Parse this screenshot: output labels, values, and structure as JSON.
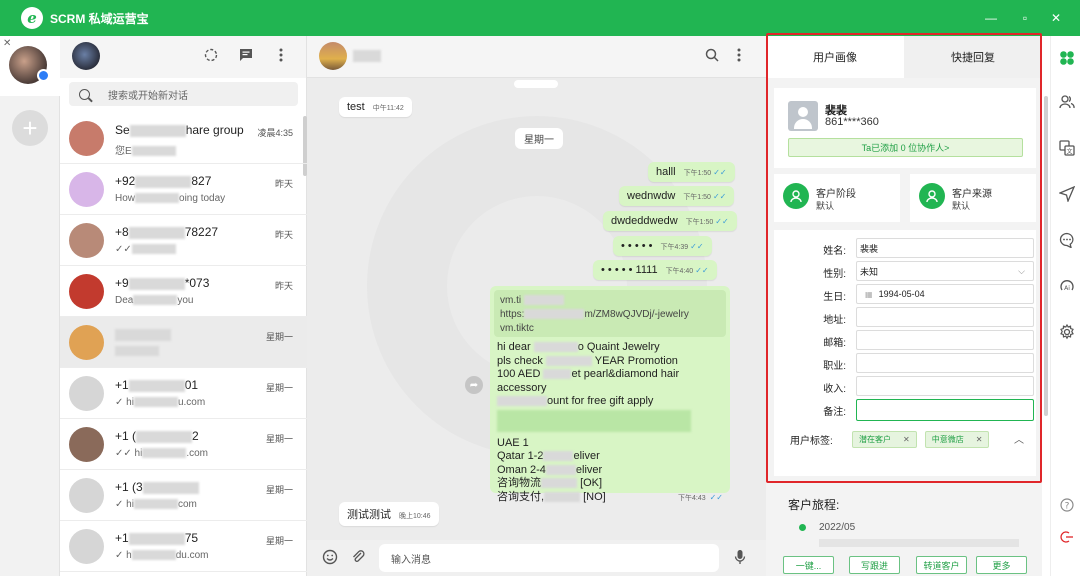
{
  "app": {
    "logo_letter": "e",
    "title": "SCRM 私域运营宝"
  },
  "window": {
    "minimize": "—",
    "maximize": "▫",
    "close": "✕"
  },
  "rail": {
    "close": "✕",
    "add": "+"
  },
  "chatlist": {
    "search_placeholder": "搜索或开始新对话",
    "items": [
      {
        "name_a": "Se",
        "name_b": "hare group",
        "preview": "您E",
        "time": "凌晨4:35",
        "avatar": "#c77b6b"
      },
      {
        "name_a": "+92",
        "name_b": "827",
        "preview": "How",
        "preview_b": "oing today",
        "time": "昨天",
        "avatar": "#d8b6e8"
      },
      {
        "name_a": "+8",
        "name_b": "78227",
        "preview": "✓✓",
        "time": "昨天",
        "avatar": "#b88a78"
      },
      {
        "name_a": "+9",
        "name_b": "*073",
        "preview": "Dea",
        "preview_b": "you",
        "time": "昨天",
        "avatar": "#c23a2e"
      },
      {
        "name_a": "",
        "name_b": "",
        "preview": "",
        "time": "星期一",
        "avatar": "#e0a254"
      },
      {
        "name_a": "+1",
        "name_b": "01",
        "preview": "✓ hi",
        "preview_b": "u.com",
        "time": "星期一",
        "avatar": "#d6d6d6"
      },
      {
        "name_a": "+1 (",
        "name_b": "2",
        "preview": "✓✓ hi",
        "preview_b": ".com",
        "time": "星期一",
        "avatar": "#8a6a5a"
      },
      {
        "name_a": "+1 (3",
        "name_b": "",
        "preview": "✓ hi",
        "preview_b": "com",
        "time": "星期一",
        "avatar": "#d6d6d6"
      },
      {
        "name_a": "+1",
        "name_b": "75",
        "preview": "✓ h",
        "preview_b": "du.com",
        "time": "星期一",
        "avatar": "#d6d6d6"
      }
    ]
  },
  "conversation": {
    "messages": {
      "m1": {
        "text": "test",
        "time": "中午11:42"
      },
      "day1": "星期一",
      "m2": {
        "text": "halll",
        "time": "下午1:50",
        "ticks": "✓✓"
      },
      "m3": {
        "text": "wednwdw",
        "time": "下午1:50",
        "ticks": "✓✓"
      },
      "m4": {
        "text": "dwdeddwedw",
        "time": "下午1:50",
        "ticks": "✓✓"
      },
      "m5": {
        "text": "• • • • •",
        "time": "下午4:39",
        "ticks": "✓✓"
      },
      "m6": {
        "text": "• • • • • 1111",
        "time": "下午4:40",
        "ticks": "✓✓"
      },
      "big": {
        "link1": "vm.ti",
        "link2": "https:",
        "link2b": "m/ZM8wQJVDj/-jewelry",
        "link3": "vm.tiktc",
        "l1a": "hi dear",
        "l1b": "o Quaint Jewelry",
        "l2a": "pls check",
        "l2b": "YEAR Promotion",
        "l3a": "100 AED",
        "l3b": "et pearl&diamond hair accessory",
        "l4": "ount for free gift apply",
        "l5": "UAE 1",
        "l6a": "Qatar 1-2",
        "l6b": "eliver",
        "l7a": "Oman 2-4",
        "l7b": "eliver",
        "l8a": "咨询物流",
        "l8b": "[OK]",
        "l9a": "咨询支付,",
        "l9b": "[NO]",
        "time": "下午4:43",
        "ticks": "✓✓"
      },
      "m7": {
        "text": "测试测试",
        "time": "晚上10:46"
      }
    },
    "input_placeholder": "输入消息"
  },
  "crm": {
    "tabs": [
      "用户画像",
      "快捷回复"
    ],
    "profile": {
      "name": "裴裴",
      "phone": "861****360",
      "collab": "Ta已添加 0 位协作人>"
    },
    "stage": {
      "title": "客户阶段",
      "value": "默认"
    },
    "source": {
      "title": "客户来源",
      "value": "默认"
    },
    "fields": [
      {
        "label": "姓名:",
        "value": "裴裴"
      },
      {
        "label": "性别:",
        "value": "未知"
      },
      {
        "label": "生日:",
        "value": "1994-05-04"
      },
      {
        "label": "地址:",
        "value": ""
      },
      {
        "label": "邮箱:",
        "value": ""
      },
      {
        "label": "职业:",
        "value": ""
      },
      {
        "label": "收入:",
        "value": ""
      },
      {
        "label": "备注:",
        "value": ""
      }
    ],
    "tags_label": "用户标签:",
    "tags": [
      "潜在客户",
      "中意微店"
    ],
    "journey_title": "客户旅程:",
    "journey_date": "2022/05",
    "actions": [
      "一键...",
      "写跟进",
      "转道客户",
      "更多"
    ]
  },
  "accent": "#21b552",
  "highlight_border": "#e0262a"
}
